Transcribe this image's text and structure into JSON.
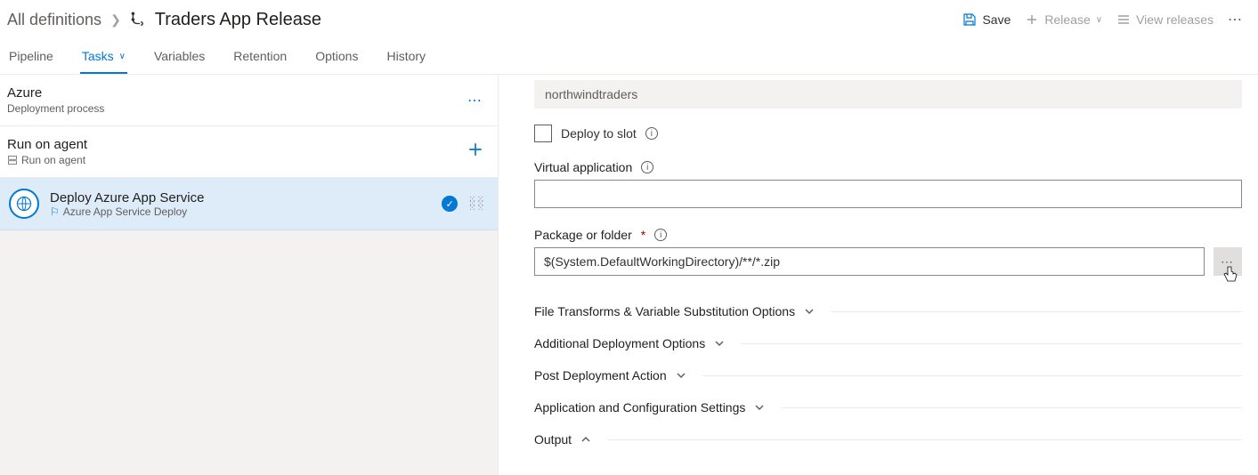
{
  "breadcrumb": {
    "root": "All definitions",
    "title": "Traders App Release"
  },
  "header": {
    "save": "Save",
    "release": "Release",
    "view_releases": "View releases"
  },
  "tabs": {
    "pipeline": "Pipeline",
    "tasks": "Tasks",
    "variables": "Variables",
    "retention": "Retention",
    "options": "Options",
    "history": "History"
  },
  "left": {
    "azure_title": "Azure",
    "azure_sub": "Deployment process",
    "agent_title": "Run on agent",
    "agent_sub": "Run on agent",
    "task_title": "Deploy Azure App Service",
    "task_sub": "Azure App Service Deploy"
  },
  "form": {
    "app_name_value": "northwindtraders",
    "deploy_to_slot": "Deploy to slot",
    "virtual_app_label": "Virtual application",
    "virtual_app_value": "",
    "package_label": "Package or folder",
    "package_value": "$(System.DefaultWorkingDirectory)/**/*.zip"
  },
  "sections": {
    "file_transforms": "File Transforms & Variable Substitution Options",
    "additional_deploy": "Additional Deployment Options",
    "post_deploy": "Post Deployment Action",
    "app_config": "Application and Configuration Settings",
    "output": "Output"
  }
}
